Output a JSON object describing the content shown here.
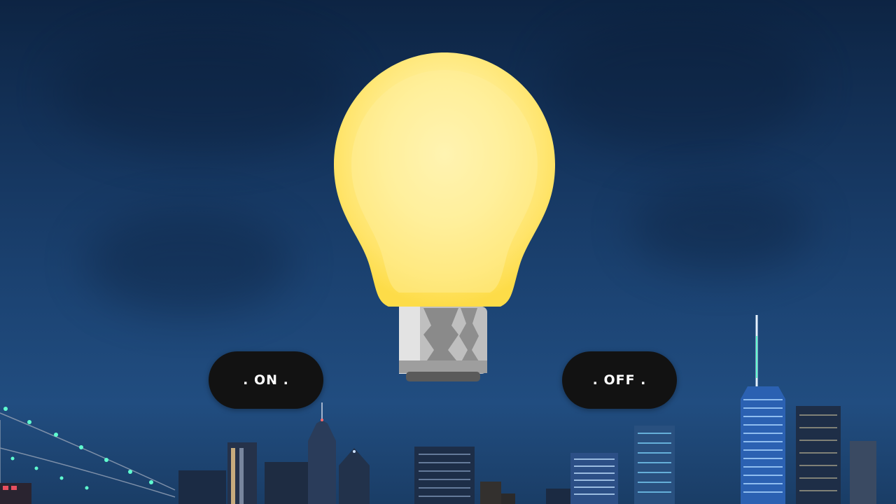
{
  "scene": {
    "background": "night-city-skyline",
    "sky_color": "#163761",
    "bulb_state": "on",
    "bulb_color": "#fde25a",
    "bulb_icon": "lightbulb-icon"
  },
  "controls": {
    "on_label": ". ON .",
    "off_label": ". OFF ."
  }
}
